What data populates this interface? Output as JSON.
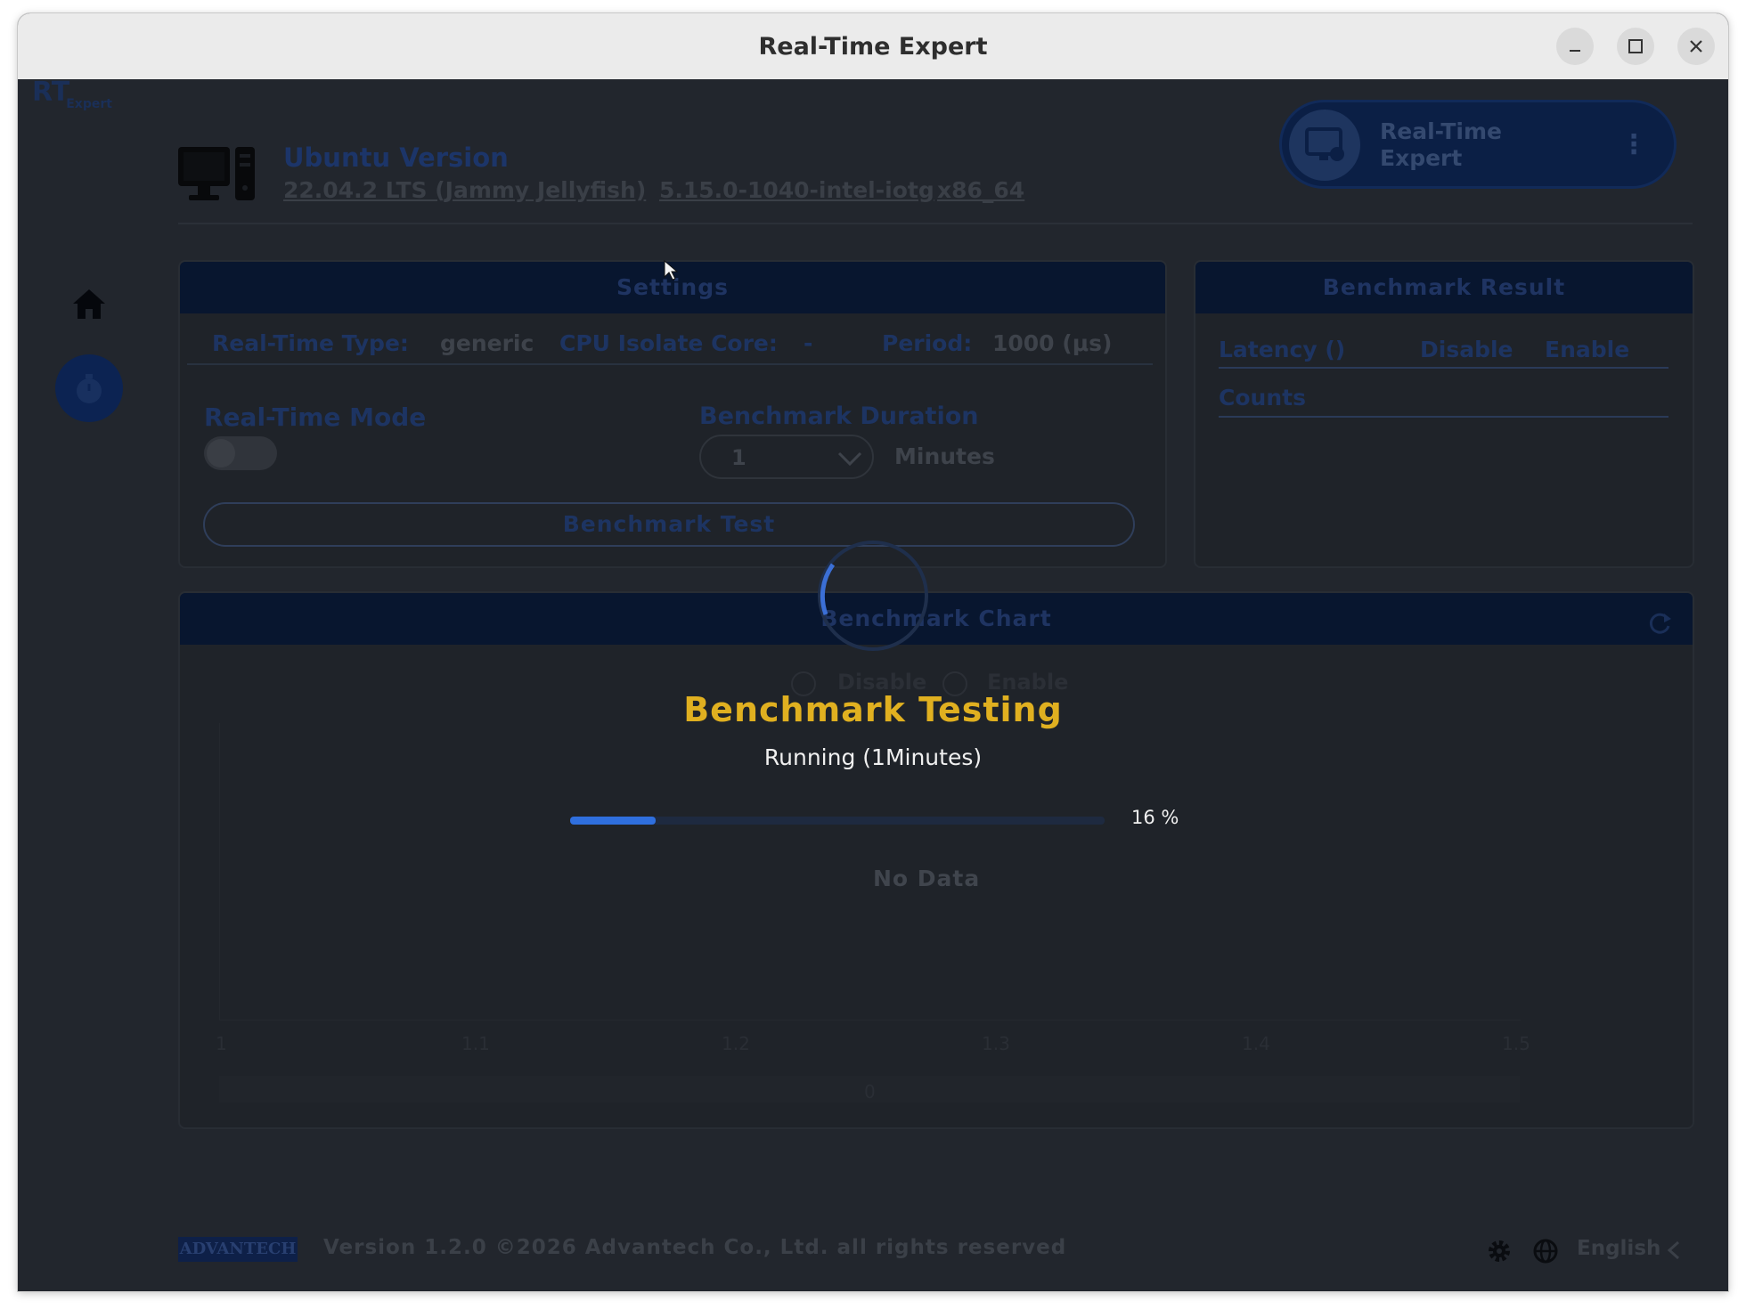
{
  "window": {
    "title": "Real-Time Expert"
  },
  "app": {
    "logo_main": "RT",
    "logo_sub": "Expert"
  },
  "header": {
    "os_label": "Ubuntu Version",
    "os_version": "22.04.2 LTS (Jammy Jellyfish)",
    "kernel": "5.15.0-1040-intel-iotg",
    "arch": "x86_64",
    "product_button_line1": "Real-Time",
    "product_button_line2": "Expert",
    "more_glyph": "⋮"
  },
  "settings": {
    "title": "Settings",
    "rt_type_label": "Real-Time Type:",
    "rt_type_value": "generic",
    "cpu_isolate_label": "CPU Isolate Core:",
    "cpu_isolate_value": "-",
    "period_label": "Period:",
    "period_value": "1000 (μs)",
    "rt_mode_label": "Real-Time Mode",
    "rt_mode_on": false,
    "duration_label": "Benchmark Duration",
    "duration_value": "1",
    "duration_unit": "Minutes",
    "benchmark_button": "Benchmark Test"
  },
  "result": {
    "title": "Benchmark Result",
    "col_latency": "Latency ()",
    "col_disable": "Disable",
    "col_enable": "Enable",
    "row_counts": "Counts"
  },
  "chart_panel": {
    "title": "Benchmark Chart",
    "legend_disable": "Disable",
    "legend_enable": "Enable",
    "no_data": "No Data",
    "x_ticks": [
      "1",
      "1.1",
      "1.2",
      "1.3",
      "1.4",
      "1.5"
    ],
    "bottom_value": "0"
  },
  "overlay": {
    "title": "Benchmark Testing",
    "subtitle": "Running (1Minutes)",
    "progress_percent": 16,
    "progress_label": "16 %"
  },
  "footer": {
    "brand": "ADVANTECH",
    "version_text": "Version 1.2.0 ©2026 Advantech Co., Ltd. all rights reserved",
    "language": "English"
  },
  "colors": {
    "overlay_title": "#e0b020",
    "progress_fill": "#2f6fde",
    "panel_header": "#08162f"
  },
  "icons": [
    "minimize-icon",
    "maximize-icon",
    "close-icon",
    "computer-icon",
    "home-icon",
    "stopwatch-icon",
    "monitor-gear-icon",
    "refresh-icon",
    "gear-icon",
    "globe-icon",
    "chevron-left-icon",
    "chevron-down-icon",
    "spinner-icon",
    "cursor-icon"
  ]
}
